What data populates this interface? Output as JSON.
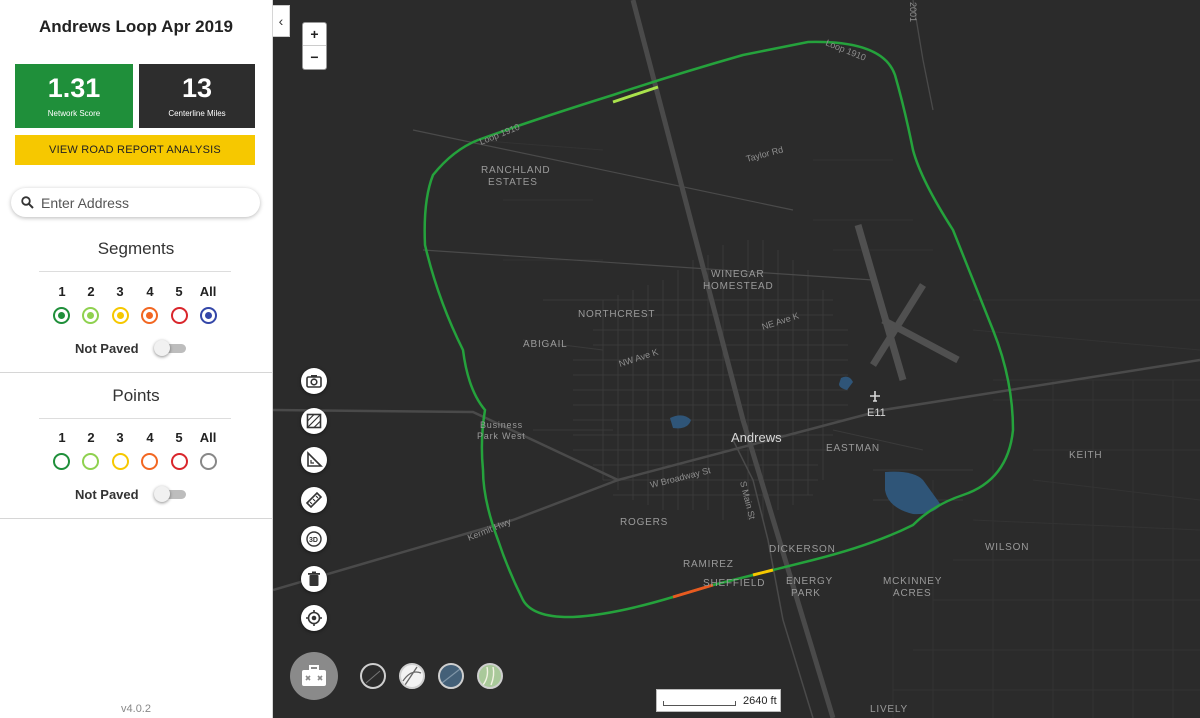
{
  "sidebar": {
    "title": "Andrews Loop Apr 2019",
    "network_score": "1.31",
    "network_score_label": "Network Score",
    "centerline_miles": "13",
    "centerline_miles_label": "Centerline Miles",
    "report_button": "VIEW ROAD REPORT ANALYSIS",
    "search_placeholder": "Enter Address",
    "segments": {
      "title": "Segments",
      "levels": [
        "1",
        "2",
        "3",
        "4",
        "5",
        "All"
      ],
      "colors": [
        "#1f8f3a",
        "#8fd14f",
        "#f6c800",
        "#f26722",
        "#d9262c",
        "#3447a8"
      ],
      "selected_all": true,
      "not_paved_label": "Not Paved",
      "not_paved_on": false
    },
    "points": {
      "title": "Points",
      "levels": [
        "1",
        "2",
        "3",
        "4",
        "5",
        "All"
      ],
      "colors": [
        "#1f8f3a",
        "#8fd14f",
        "#f6c800",
        "#f26722",
        "#d9262c",
        "#888888"
      ],
      "not_paved_label": "Not Paved",
      "not_paved_on": false
    },
    "version": "v4.0.2",
    "collapse_icon": "chevron-left-icon"
  },
  "map": {
    "zoom_in": "+",
    "zoom_out": "−",
    "tools": [
      "camera-icon",
      "map-export-icon",
      "measure-angle-icon",
      "ruler-icon",
      "3d-view-icon",
      "trash-icon",
      "locate-icon"
    ],
    "basemaps": [
      "dark-basemap-icon",
      "light-basemap-icon",
      "satellite-basemap-icon",
      "terrain-basemap-icon"
    ],
    "scale_label": "2640 ft",
    "labels": {
      "city": "Andrews",
      "ranchland1": "RANCHLAND",
      "ranchland2": "ESTATES",
      "winegar1": "WINEGAR",
      "winegar2": "HOMESTEAD",
      "northcrest": "NORTHCREST",
      "abigail": "ABIGAIL",
      "business1": "Business",
      "business2": "Park West",
      "eastman": "EASTMAN",
      "keith": "KEITH",
      "rogers": "ROGERS",
      "ramirez": "RAMIREZ",
      "sheffield": "SHEFFIELD",
      "dickerson": "DICKERSON",
      "energy1": "ENERGY",
      "energy2": "PARK",
      "mckinney1": "MCKINNEY",
      "mckinney2": "ACRES",
      "wilson": "WILSON",
      "lively": "LIVELY",
      "airport": "E11",
      "loop_top": "Loop 1910",
      "loop_left": "Loop 1910",
      "taylor": "Taylor Rd",
      "ne_ave_k": "NE Ave K",
      "nw_ave_k": "NW Ave K",
      "w_broadway": "W Broadway St",
      "s_main": "S Main St",
      "kermit": "Kermit Hwy",
      "hwy_code": "2001"
    }
  }
}
